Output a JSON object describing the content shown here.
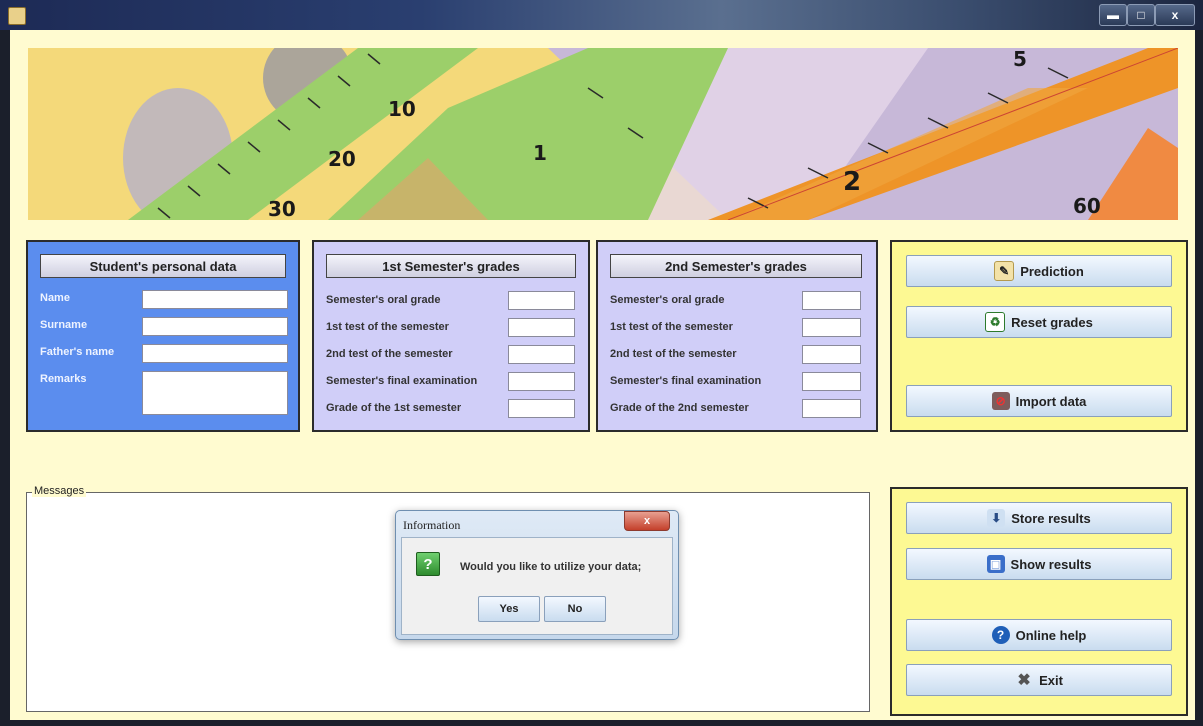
{
  "window": {
    "minimize_glyph": "▬",
    "maximize_glyph": "□",
    "close_glyph": "x"
  },
  "personal": {
    "title": "Student's personal data",
    "fields": [
      "Name",
      "Surname",
      "Father's name",
      "Remarks"
    ]
  },
  "sem1": {
    "title": "1st Semester's grades",
    "fields": [
      "Semester's oral grade",
      "1st test of the semester",
      "2nd test of the semester",
      "Semester's final examination",
      "Grade of the 1st semester"
    ]
  },
  "sem2": {
    "title": "2nd Semester's grades",
    "fields": [
      "Semester's oral grade",
      "1st test of the semester",
      "2nd test of the semester",
      "Semester's final examination",
      "Grade of the 2nd semester"
    ]
  },
  "actions": {
    "prediction": "Prediction",
    "reset": "Reset grades",
    "import": "Import data",
    "store": "Store results",
    "show": "Show results",
    "help": "Online help",
    "exit": "Exit"
  },
  "messages": {
    "title": "Messages"
  },
  "dialog": {
    "title": "Information",
    "close": "x",
    "icon_glyph": "?",
    "message": "Would you like to utilize your data;",
    "yes": "Yes",
    "no": "No"
  },
  "banner": {
    "ticks": [
      "10",
      "20",
      "30",
      "1",
      "2",
      "5",
      "60"
    ]
  },
  "colors": {
    "client_bg": "#fffbd0",
    "personal_panel": "#5b8dee",
    "semester_panel": "#d0cef8",
    "action_panel": "#fdf993"
  }
}
